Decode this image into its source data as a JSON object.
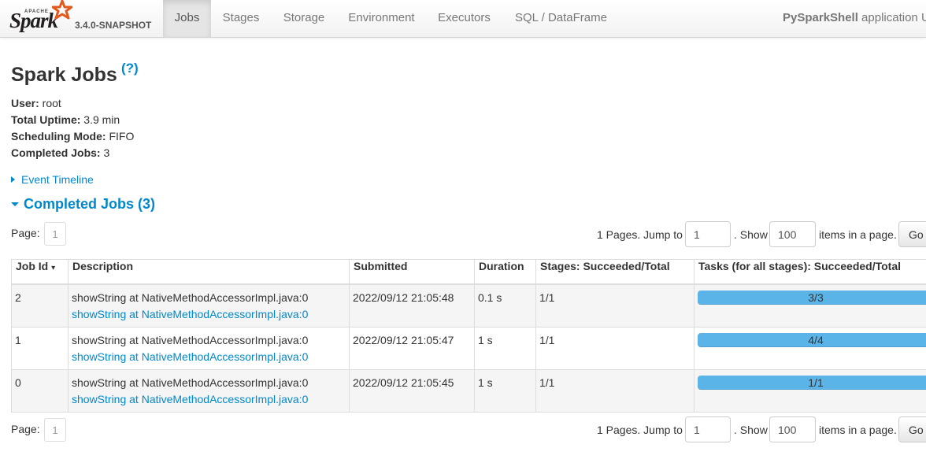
{
  "navbar": {
    "brand_apache": "APACHE",
    "brand_name": "Spark",
    "version": "3.4.0-SNAPSHOT",
    "tabs": [
      {
        "label": "Jobs",
        "active": true
      },
      {
        "label": "Stages"
      },
      {
        "label": "Storage"
      },
      {
        "label": "Environment"
      },
      {
        "label": "Executors"
      },
      {
        "label": "SQL / DataFrame"
      }
    ],
    "app_name": "PySparkShell",
    "app_suffix": " application U"
  },
  "page": {
    "title": "Spark Jobs",
    "help": "(?)"
  },
  "summary": {
    "user_label": "User:",
    "user_value": " root",
    "uptime_label": "Total Uptime:",
    "uptime_value": " 3.9 min",
    "mode_label": "Scheduling Mode:",
    "mode_value": " FIFO",
    "completed_label": "Completed Jobs:",
    "completed_value": " 3"
  },
  "event_timeline": "Event Timeline",
  "section": {
    "title": "Completed Jobs (3)"
  },
  "pagination": {
    "page_label": "Page:",
    "current_page": "1",
    "pages_text": "1 Pages. Jump to",
    "jump_value": "1",
    "show_text": ". Show",
    "show_value": "100",
    "items_text": "items in a page.",
    "go_label": "Go"
  },
  "table": {
    "headers": [
      "Job Id",
      "Description",
      "Submitted",
      "Duration",
      "Stages: Succeeded/Total",
      "Tasks (for all stages): Succeeded/Total"
    ],
    "sort_indicator": "▾",
    "rows": [
      {
        "job_id": "2",
        "desc": "showString at NativeMethodAccessorImpl.java:0",
        "desc_link": "showString at NativeMethodAccessorImpl.java:0",
        "submitted": "2022/09/12 21:05:48",
        "duration": "0.1 s",
        "stages": "1/1",
        "tasks": "3/3",
        "tasks_fraction": 1.0
      },
      {
        "job_id": "1",
        "desc": "showString at NativeMethodAccessorImpl.java:0",
        "desc_link": "showString at NativeMethodAccessorImpl.java:0",
        "submitted": "2022/09/12 21:05:47",
        "duration": "1 s",
        "stages": "1/1",
        "tasks": "4/4",
        "tasks_fraction": 1.0
      },
      {
        "job_id": "0",
        "desc": "showString at NativeMethodAccessorImpl.java:0",
        "desc_link": "showString at NativeMethodAccessorImpl.java:0",
        "submitted": "2022/09/12 21:05:45",
        "duration": "1 s",
        "stages": "1/1",
        "tasks": "1/1",
        "tasks_fraction": 1.0
      }
    ]
  },
  "colors": {
    "link": "#0088cc",
    "progress": "#5ab4e8",
    "star": "#e25a1c"
  }
}
